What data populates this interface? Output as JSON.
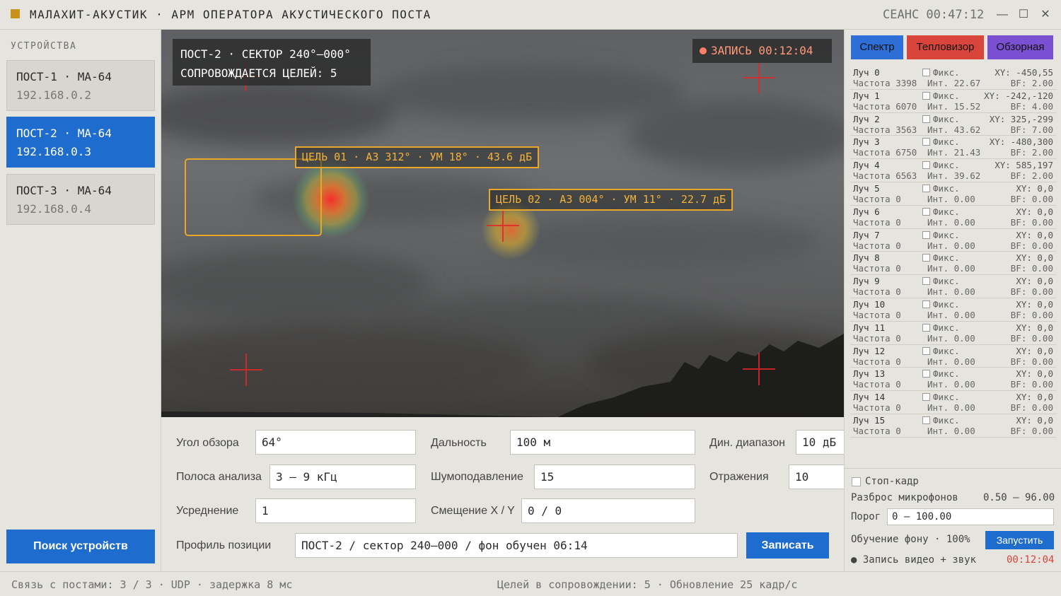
{
  "titlebar": {
    "title": "МАЛАХИТ-АКУСТИК · АРМ ОПЕРАТОРА АКУСТИЧЕСКОГО ПОСТА",
    "session": "СЕАНС 00:47:12",
    "minimize": "—",
    "maximize": "☐",
    "close": "✕",
    "logo_color": "#c8921a"
  },
  "sidebar": {
    "section_label": "УСТРОЙСТВА",
    "devices": [
      {
        "name": "ПОСТ-1 · МА-64",
        "ip": "192.168.0.2",
        "active": false
      },
      {
        "name": "ПОСТ-2 · МА-64",
        "ip": "192.168.0.3",
        "active": true
      },
      {
        "name": "ПОСТ-3 · МА-64",
        "ip": "192.168.0.4",
        "active": false
      }
    ],
    "search_button": "Поиск устройств"
  },
  "video": {
    "info_line1": "ПОСТ-2 · СЕКТОР 240°–000°",
    "info_line2": "СОПРОВОЖДАЕТСЯ ЦЕЛЕЙ: 5",
    "recording": "ЗАПИСЬ 00:12:04",
    "targets": [
      {
        "label": "ЦЕЛЬ 01 · АЗ 312° · УМ 18° · 43.6 дБ"
      },
      {
        "label": "ЦЕЛЬ 02 · АЗ 004° · УМ 11° · 22.7 дБ"
      }
    ],
    "accent_color": "#e8a72a"
  },
  "controls": {
    "view_angle": {
      "label": "Угол обзора",
      "value": "64°"
    },
    "range": {
      "label": "Дальность",
      "value": "100 м"
    },
    "dyn_range": {
      "label": "Дин. диапазон",
      "value": "10 дБ"
    },
    "band": {
      "label": "Полоса анализа",
      "value": "3 — 9 кГц"
    },
    "noise": {
      "label": "Шумоподавление",
      "value": "15"
    },
    "reflections": {
      "label": "Отражения",
      "value": "10"
    },
    "averaging": {
      "label": "Усреднение",
      "value": "1"
    },
    "offset": {
      "label": "Смещение X / Y",
      "value": "0 / 0"
    },
    "profile": {
      "label": "Профиль позиции",
      "value": "ПОСТ-2 / сектор 240–000 / фон обучен 06:14"
    },
    "save_button": "Записать"
  },
  "right_panel": {
    "tabs": [
      {
        "label": "Спектр",
        "color": "#2d6fd6"
      },
      {
        "label": "Тепловизор",
        "color": "#d9453b"
      },
      {
        "label": "Обзорная",
        "color": "#7a4fd1"
      }
    ],
    "beams": [
      {
        "name": "Луч 0",
        "fix": "Фикс.",
        "xy": "XY: -450,55",
        "freq": "Частота 3398",
        "int": "Инт. 22.67",
        "bf": "BF: 2.00"
      },
      {
        "name": "Луч 1",
        "fix": "Фикс.",
        "xy": "XY: -242,-120",
        "freq": "Частота 6070",
        "int": "Инт. 15.52",
        "bf": "BF: 4.00"
      },
      {
        "name": "Луч 2",
        "fix": "Фикс.",
        "xy": "XY: 325,-299",
        "freq": "Частота 3563",
        "int": "Инт. 43.62",
        "bf": "BF: 7.00"
      },
      {
        "name": "Луч 3",
        "fix": "Фикс.",
        "xy": "XY: -480,300",
        "freq": "Частота 6750",
        "int": "Инт. 21.43",
        "bf": "BF: 2.00"
      },
      {
        "name": "Луч 4",
        "fix": "Фикс.",
        "xy": "XY: 585,197",
        "freq": "Частота 6563",
        "int": "Инт. 39.62",
        "bf": "BF: 2.00"
      },
      {
        "name": "Луч 5",
        "fix": "Фикс.",
        "xy": "XY: 0,0",
        "freq": "Частота 0",
        "int": "Инт. 0.00",
        "bf": "BF: 0.00"
      },
      {
        "name": "Луч 6",
        "fix": "Фикс.",
        "xy": "XY: 0,0",
        "freq": "Частота 0",
        "int": "Инт. 0.00",
        "bf": "BF: 0.00"
      },
      {
        "name": "Луч 7",
        "fix": "Фикс.",
        "xy": "XY: 0,0",
        "freq": "Частота 0",
        "int": "Инт. 0.00",
        "bf": "BF: 0.00"
      },
      {
        "name": "Луч 8",
        "fix": "Фикс.",
        "xy": "XY: 0,0",
        "freq": "Частота 0",
        "int": "Инт. 0.00",
        "bf": "BF: 0.00"
      },
      {
        "name": "Луч 9",
        "fix": "Фикс.",
        "xy": "XY: 0,0",
        "freq": "Частота 0",
        "int": "Инт. 0.00",
        "bf": "BF: 0.00"
      },
      {
        "name": "Луч 10",
        "fix": "Фикс.",
        "xy": "XY: 0,0",
        "freq": "Частота 0",
        "int": "Инт. 0.00",
        "bf": "BF: 0.00"
      },
      {
        "name": "Луч 11",
        "fix": "Фикс.",
        "xy": "XY: 0,0",
        "freq": "Частота 0",
        "int": "Инт. 0.00",
        "bf": "BF: 0.00"
      },
      {
        "name": "Луч 12",
        "fix": "Фикс.",
        "xy": "XY: 0,0",
        "freq": "Частота 0",
        "int": "Инт. 0.00",
        "bf": "BF: 0.00"
      },
      {
        "name": "Луч 13",
        "fix": "Фикс.",
        "xy": "XY: 0,0",
        "freq": "Частота 0",
        "int": "Инт. 0.00",
        "bf": "BF: 0.00"
      },
      {
        "name": "Луч 14",
        "fix": "Фикс.",
        "xy": "XY: 0,0",
        "freq": "Частота 0",
        "int": "Инт. 0.00",
        "bf": "BF: 0.00"
      },
      {
        "name": "Луч 15",
        "fix": "Фикс.",
        "xy": "XY: 0,0",
        "freq": "Частота 0",
        "int": "Инт. 0.00",
        "bf": "BF: 0.00"
      }
    ],
    "freeze_label": "Стоп-кадр",
    "mic_spread_label": "Разброс микрофонов",
    "mic_spread_value": "0.50 — 96.00",
    "threshold_label": "Порог",
    "threshold_value": "0 — 100.00",
    "training_label": "Обучение фону · 100%",
    "start_button": "Запустить",
    "recording_label": "● Запись видео + звук",
    "recording_time": "00:12:04",
    "recording_time_color": "#d9453b"
  },
  "statusbar": {
    "left": "Связь с постами: 3 / 3 · UDP · задержка 8 мс",
    "right": "Целей в сопровождении: 5 · Обновление 25 кадр/с"
  }
}
